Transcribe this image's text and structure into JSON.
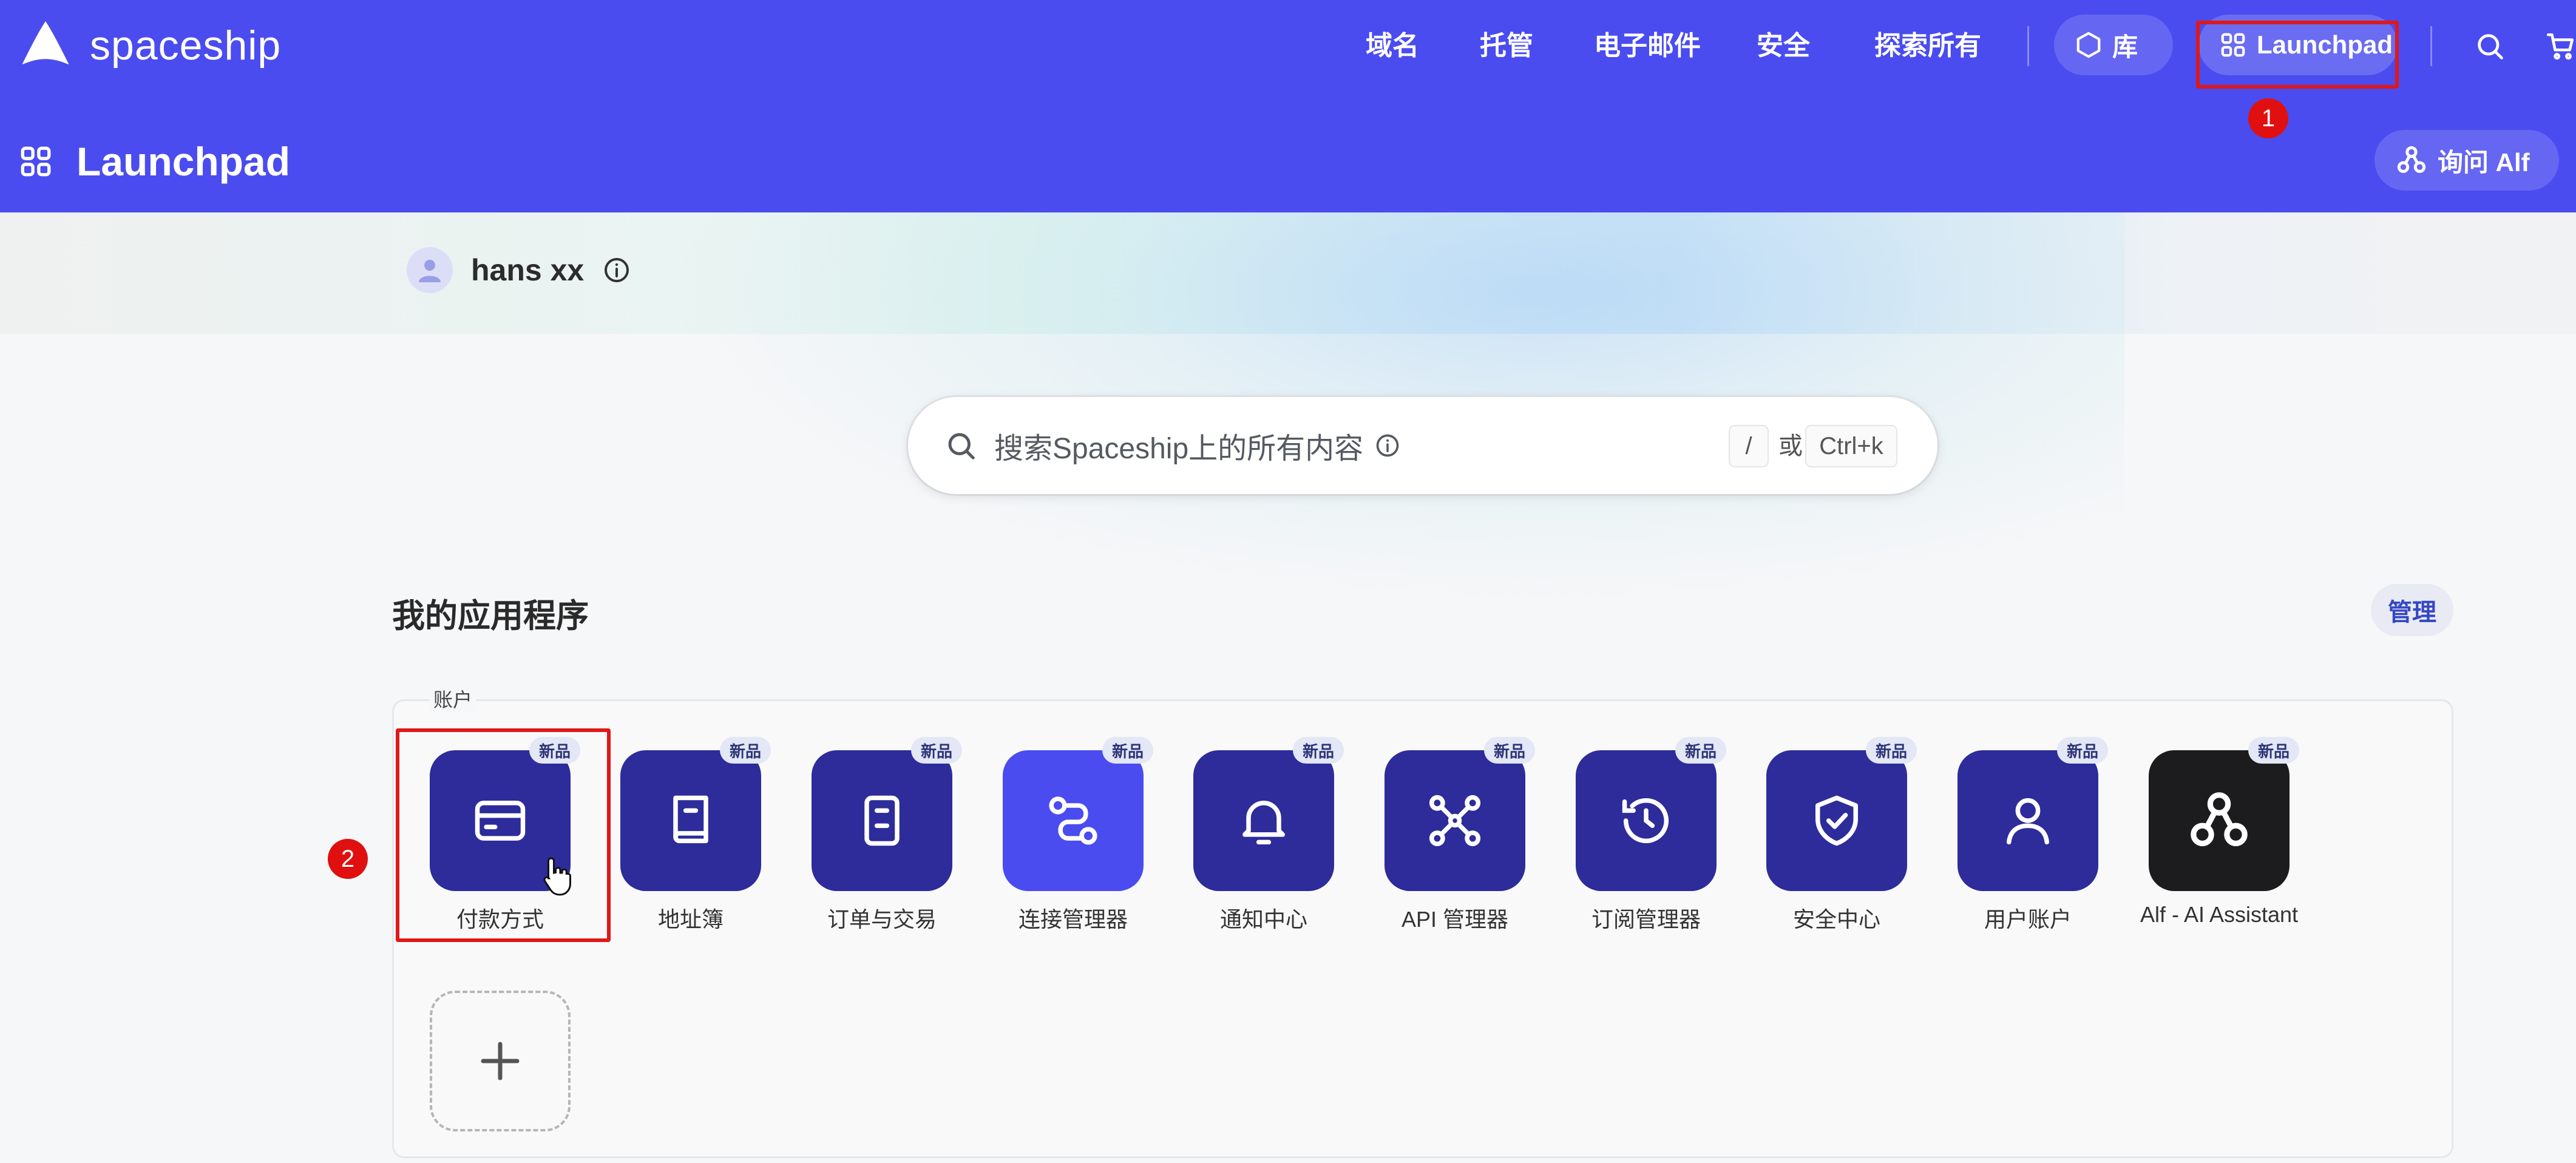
{
  "brand": {
    "name": "spaceship"
  },
  "nav": {
    "items": [
      "域名",
      "托管",
      "电子邮件",
      "安全",
      "探索所有"
    ],
    "library_label": "库",
    "launchpad_label": "Launchpad"
  },
  "subheader": {
    "title": "Launchpad",
    "ask_alf_label": "询问 Alf"
  },
  "user": {
    "name": "hans xx"
  },
  "search": {
    "placeholder": "搜索Spaceship上的所有内容",
    "shortcut_key": "/",
    "or_text": "或",
    "shortcut_combo": "Ctrl+k"
  },
  "apps_section": {
    "title": "我的应用程序",
    "manage_label": "管理",
    "group_label": "账户",
    "new_badge": "新品",
    "apps": [
      {
        "label": "付款方式",
        "icon": "credit-card-icon"
      },
      {
        "label": "地址簿",
        "icon": "address-book-icon"
      },
      {
        "label": "订单与交易",
        "icon": "orders-icon"
      },
      {
        "label": "连接管理器",
        "icon": "connection-icon"
      },
      {
        "label": "通知中心",
        "icon": "bell-icon"
      },
      {
        "label": "API 管理器",
        "icon": "api-icon"
      },
      {
        "label": "订阅管理器",
        "icon": "subscription-icon"
      },
      {
        "label": "安全中心",
        "icon": "shield-icon"
      },
      {
        "label": "用户账户",
        "icon": "user-icon"
      },
      {
        "label": "Alf - AI Assistant",
        "icon": "alf-icon"
      }
    ]
  },
  "annotations": {
    "step1": "1",
    "step2": "2"
  },
  "colors": {
    "topbar": "#4a4cf0",
    "app_icon": "#2d2c9a",
    "highlight": "#e01818"
  }
}
